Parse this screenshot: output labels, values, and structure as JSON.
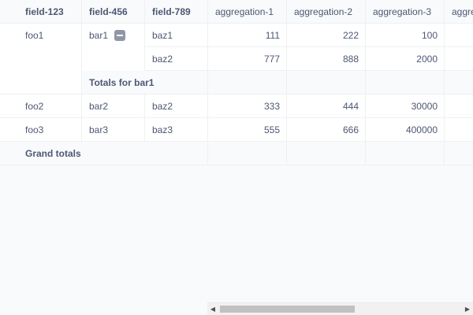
{
  "pivot": {
    "row_headers": [
      "field-123",
      "field-456",
      "field-789"
    ],
    "value_headers": [
      "aggregation-1",
      "aggregation-2",
      "aggregation-3",
      "aggre"
    ],
    "rows": [
      {
        "f1": "foo1",
        "f2": "bar1",
        "f3": "baz1",
        "values": [
          "111",
          "222",
          "100"
        ]
      },
      {
        "f3": "baz2",
        "values": [
          "777",
          "888",
          "2000"
        ]
      },
      {
        "f1": "foo2",
        "f2": "bar2",
        "f3": "baz2",
        "values": [
          "333",
          "444",
          "30000"
        ]
      },
      {
        "f1": "foo3",
        "f2": "bar3",
        "f3": "baz3",
        "values": [
          "555",
          "666",
          "400000"
        ]
      }
    ],
    "subtotal_label": "Totals for bar1",
    "grand_total_label": "Grand totals"
  },
  "icons": {
    "collapse": "minus-square-icon",
    "scroll_left": "chevron-left-icon",
    "scroll_right": "chevron-right-icon"
  },
  "colors": {
    "text": "#4c5773",
    "header_bg": "#f9fafb",
    "border": "#eef0f3",
    "collapse_button": "#8f97a6"
  }
}
